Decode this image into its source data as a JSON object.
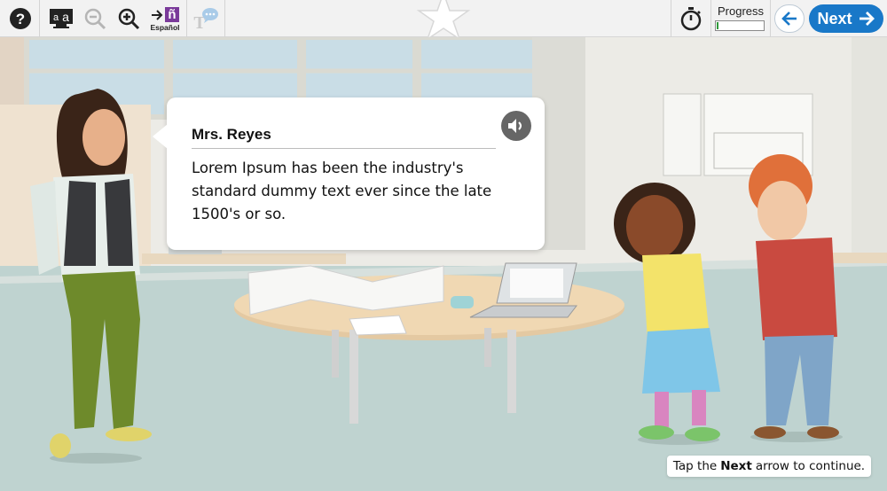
{
  "toolbar": {
    "help_icon": "help-icon",
    "font_size_icon": "font-size-icon",
    "zoom_out_icon": "zoom-out-icon",
    "zoom_in_icon": "zoom-in-icon",
    "language_label": "Español",
    "language_glyph": "ñ",
    "glossary_icon": "text-speech-icon",
    "timer_icon": "stopwatch-icon",
    "progress_label": "Progress",
    "progress_fraction": 0.04,
    "back_icon": "arrow-left-icon",
    "next_label": "Next",
    "colors": {
      "accent": "#1978c8",
      "language": "#7a3a9a",
      "progress": "#2e9a3a"
    }
  },
  "dialog": {
    "speaker": "Mrs. Reyes",
    "text": "Lorem Ipsum has been the industry's standard dummy text ever since the late 1500's or so.",
    "audio_icon": "speaker-audio-icon"
  },
  "hint": {
    "prefix": "Tap the",
    "bold": "Next",
    "suffix": "arrow to continue."
  }
}
